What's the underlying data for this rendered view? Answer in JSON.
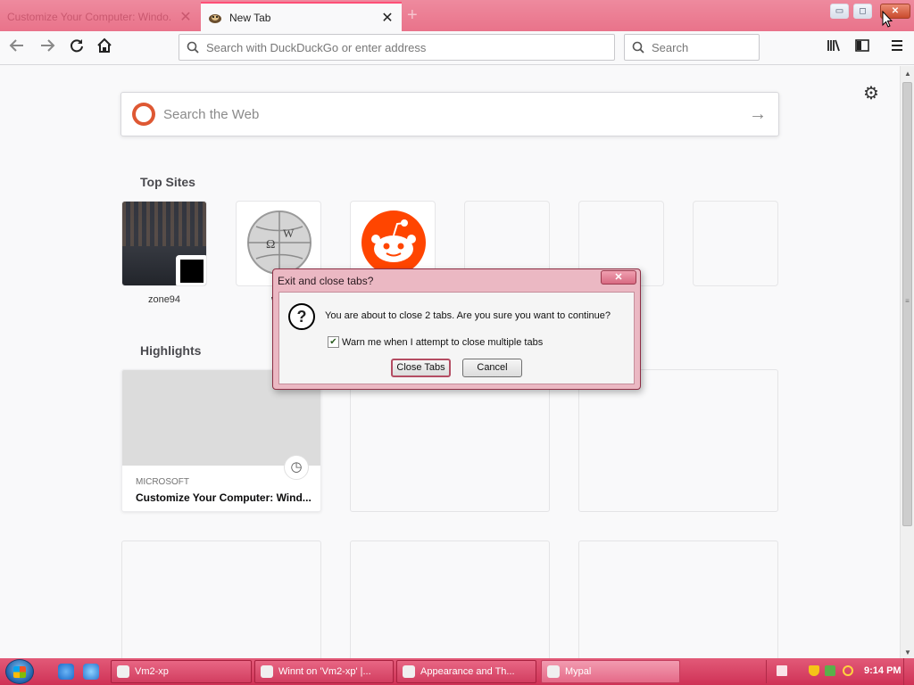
{
  "tabs": [
    {
      "label": "Customize Your Computer: Windo...",
      "active": false
    },
    {
      "label": "New Tab",
      "active": true
    }
  ],
  "window_controls": {
    "minimize": "▭",
    "maximize": "◻",
    "close": "✕"
  },
  "navbar": {
    "url_placeholder": "Search with DuckDuckGo or enter address",
    "search_placeholder": "Search"
  },
  "newtab": {
    "web_search_placeholder": "Search the Web",
    "top_sites_title": "Top Sites",
    "top_sites": [
      {
        "label": "zone94",
        "icon": "zone94-thumbnail"
      },
      {
        "label": "wik",
        "icon": "wikipedia-globe-icon"
      },
      {
        "label": "",
        "icon": "reddit-icon"
      }
    ],
    "highlights_title": "Highlights",
    "highlight": {
      "source": "MICROSOFT",
      "title": "Customize Your Computer: Wind..."
    }
  },
  "dialog": {
    "title": "Exit and close tabs?",
    "message": "You are about to close 2 tabs. Are you sure you want to continue?",
    "checkbox_label": "Warn me when I attempt to close multiple tabs",
    "checkbox_checked": true,
    "close_tabs_label": "Close Tabs",
    "cancel_label": "Cancel"
  },
  "taskbar": {
    "tasks": [
      {
        "label": "Vm2-xp"
      },
      {
        "label": "Winnt on 'Vm2-xp' |..."
      },
      {
        "label": "Appearance and Th..."
      },
      {
        "label": "Mypal"
      }
    ],
    "clock": "9:14 PM"
  },
  "colors": {
    "theme_pink": "#e9738a",
    "taskbar": "#d23e60",
    "dialog_border": "#8d2f45",
    "ddg_orange": "#de5833",
    "reddit_orange": "#ff4500"
  }
}
